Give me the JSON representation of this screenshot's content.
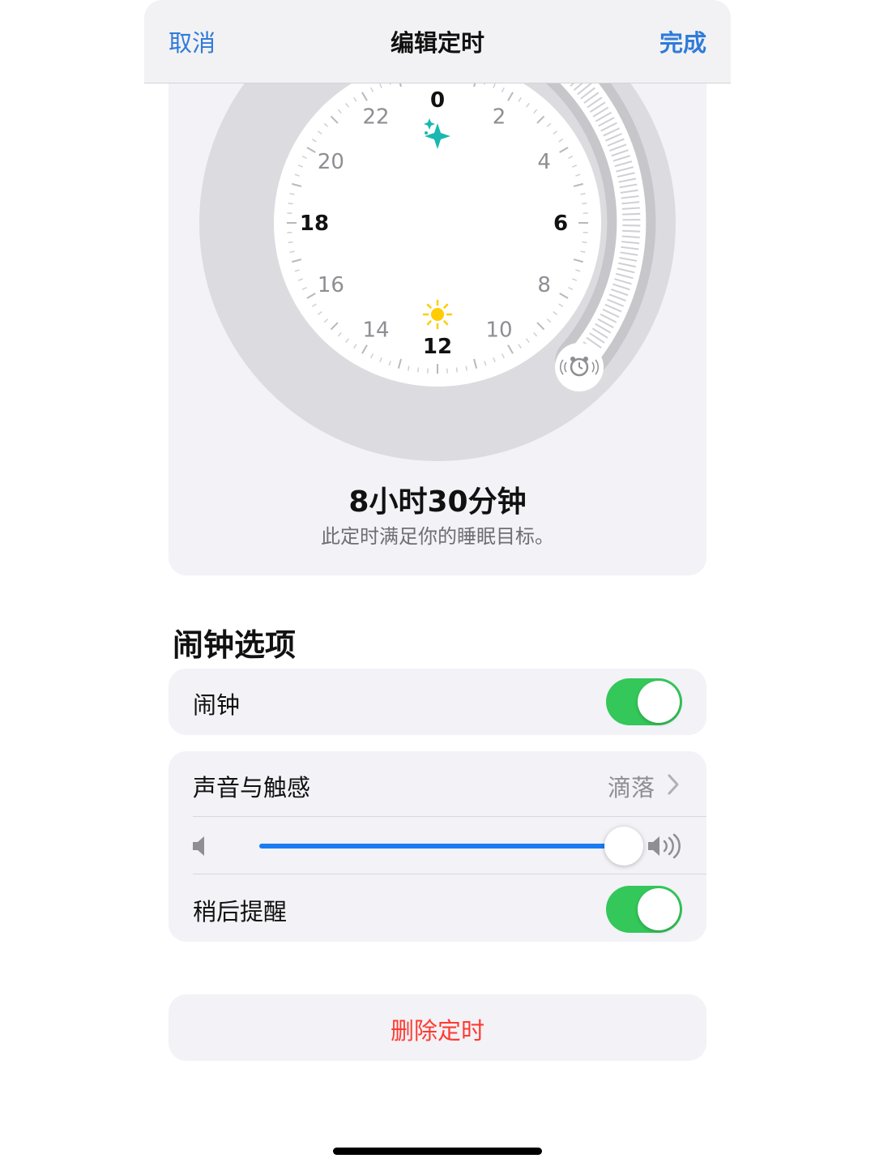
{
  "navbar": {
    "cancel_label": "取消",
    "title": "编辑定时",
    "done_label": "完成",
    "accent_color": "#2f7bd9"
  },
  "clock": {
    "hour_labels": [
      "0",
      "2",
      "4",
      "6",
      "8",
      "10",
      "12",
      "14",
      "16",
      "18",
      "20",
      "22"
    ],
    "bedtime_icon": "sparkles-icon",
    "bedtime_icon_color": "#1ab8b0",
    "wake_icon": "sun-icon",
    "wake_icon_color": "#ffcc00",
    "alarm_icon": "alarm-clock-icon",
    "duration_text": "8小时30分钟",
    "goal_text": "此定时满足你的睡眠目标。"
  },
  "alarm_options": {
    "section_title": "闹钟选项",
    "alarm_label": "闹钟",
    "alarm_on": true,
    "sound_label": "声音与触感",
    "sound_value": "滴落",
    "volume_level": 0.9,
    "snooze_label": "稍后提醒",
    "snooze_on": true,
    "toggle_color": "#34c759"
  },
  "delete": {
    "label": "删除定时",
    "color": "#ff3b30"
  }
}
